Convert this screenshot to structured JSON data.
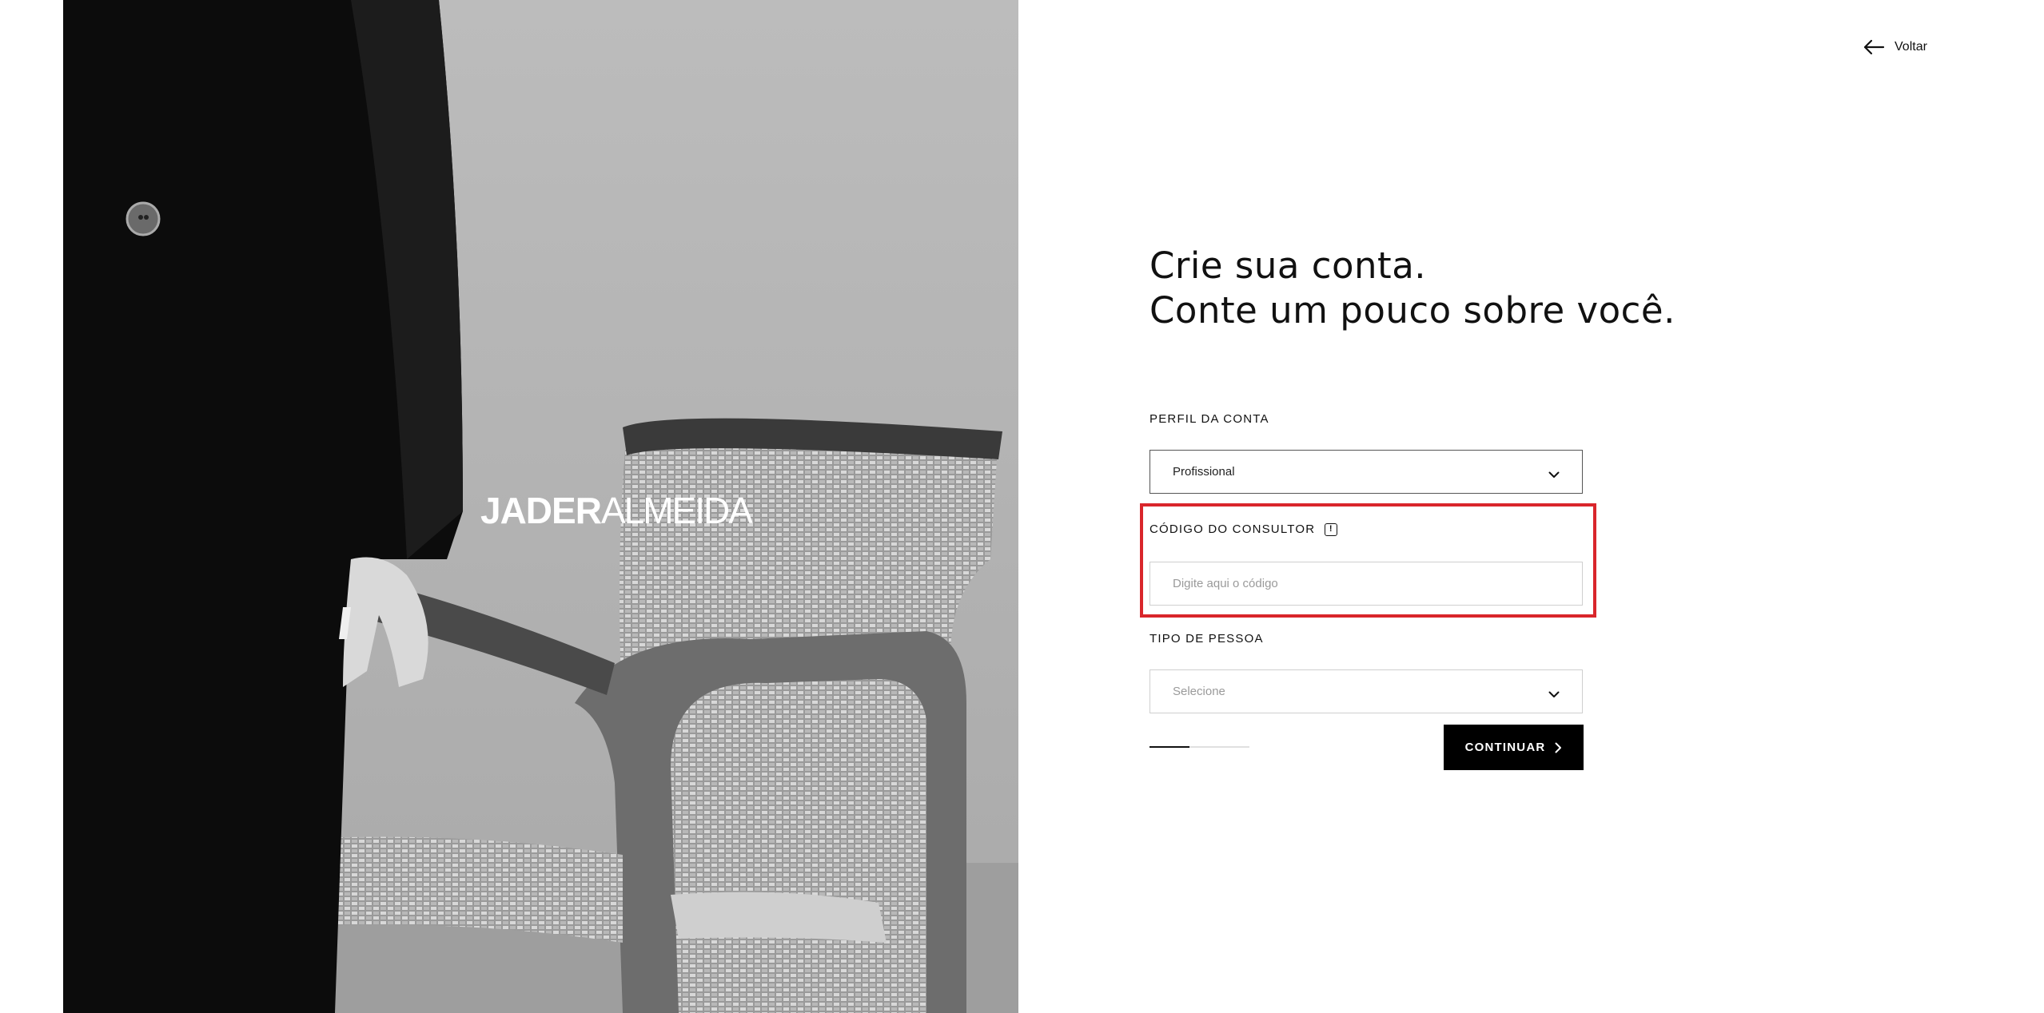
{
  "hero": {
    "brand_bold": "JADER",
    "brand_light": "ALMEIDA",
    "image_icon": "photo-person-with-woven-chair"
  },
  "back_link": {
    "label": "Voltar",
    "icon": "arrow-left-icon"
  },
  "headline": {
    "line1": "Crie sua conta.",
    "line2": "Conte um pouco sobre você."
  },
  "form": {
    "account_profile": {
      "label": "PERFIL DA CONTA",
      "value": "Profissional",
      "icon": "chevron-down-icon"
    },
    "consultant_code": {
      "label": "CÓDIGO DO CONSULTOR",
      "info_icon": "info-icon",
      "info_glyph": "!",
      "placeholder": "Digite aqui o código",
      "value": ""
    },
    "person_type": {
      "label": "TIPO DE PESSOA",
      "placeholder": "Selecione",
      "icon": "chevron-down-icon"
    }
  },
  "progress": {
    "step_fraction": 0.4
  },
  "continue_button": {
    "label": "CONTINUAR",
    "icon": "chevron-right-icon"
  },
  "colors": {
    "highlight": "#d9262b",
    "button_bg": "#000000",
    "button_text": "#ffffff",
    "border": "#cfcfcf"
  }
}
